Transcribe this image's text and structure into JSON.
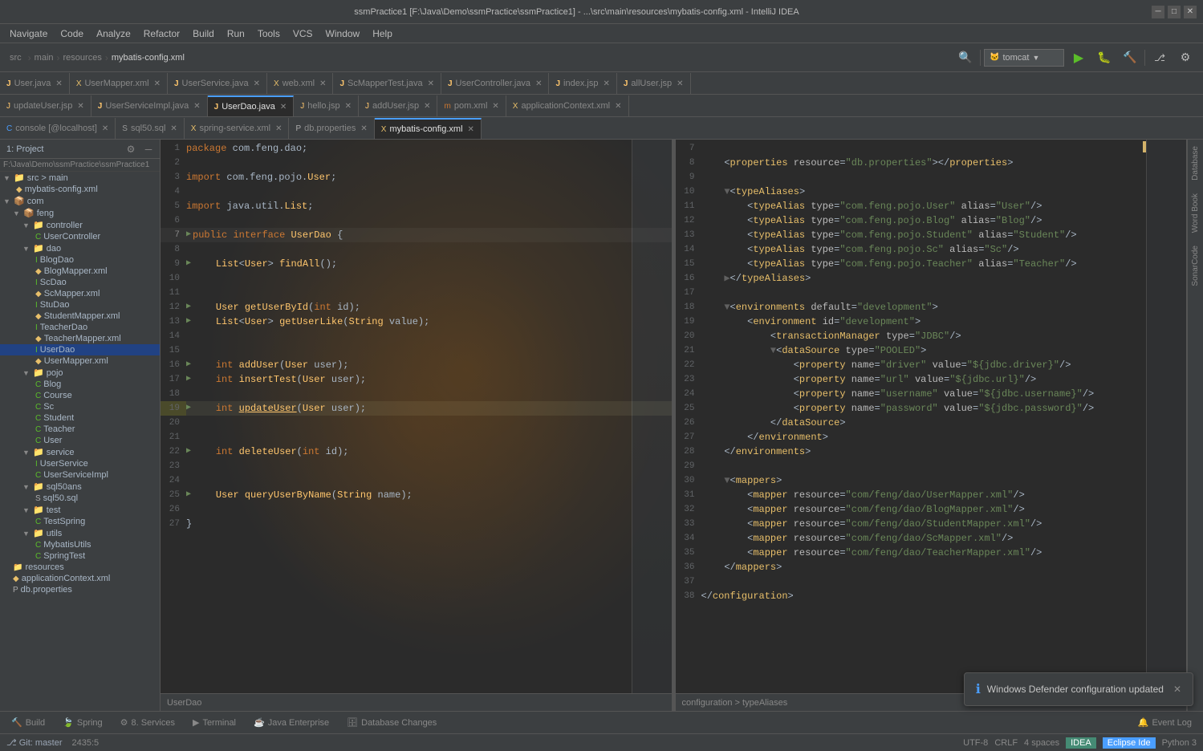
{
  "title_bar": {
    "title": "ssmPractice1 [F:\\Java\\Demo\\ssmPractice\\ssmPractice1] - ...\\src\\main\\resources\\mybatis-config.xml - IntelliJ IDEA"
  },
  "menu": {
    "items": [
      "Navigate",
      "Code",
      "Analyze",
      "Refactor",
      "Build",
      "Run",
      "Tools",
      "VCS",
      "Window",
      "Help"
    ]
  },
  "toolbar": {
    "path": "src  main  resources  mybatis-config.xml",
    "tomcat_label": "tomcat"
  },
  "tabs_row1": [
    {
      "label": "User.java",
      "active": false,
      "icon": "J"
    },
    {
      "label": "UserMapper.xml",
      "active": false,
      "icon": "X"
    },
    {
      "label": "UserService.java",
      "active": false,
      "icon": "J"
    },
    {
      "label": "web.xml",
      "active": false,
      "icon": "X"
    },
    {
      "label": "ScMapperTest.java",
      "active": false,
      "icon": "J"
    },
    {
      "label": "UserController.java",
      "active": false,
      "icon": "J"
    },
    {
      "label": "index.jsp",
      "active": false,
      "icon": "J"
    },
    {
      "label": "allUser.jsp",
      "active": false,
      "icon": "J"
    }
  ],
  "tabs_row2": [
    {
      "label": "updateUser.jsp",
      "active": false,
      "icon": "J"
    },
    {
      "label": "UserServiceImpl.java",
      "active": false,
      "icon": "J"
    },
    {
      "label": "UserDao.java",
      "active": true,
      "icon": "J"
    },
    {
      "label": "hello.jsp",
      "active": false,
      "icon": "J"
    },
    {
      "label": "addUser.jsp",
      "active": false,
      "icon": "J"
    },
    {
      "label": "pom.xml",
      "active": false,
      "icon": "X"
    },
    {
      "label": "applicationContext.xml",
      "active": false,
      "icon": "X"
    }
  ],
  "tabs_row3": [
    {
      "label": "console [@localhost]",
      "active": false,
      "icon": "C"
    },
    {
      "label": "sql50.sql",
      "active": false,
      "icon": "S"
    },
    {
      "label": "spring-service.xml",
      "active": false,
      "icon": "X"
    },
    {
      "label": "db.properties",
      "active": false,
      "icon": "P"
    },
    {
      "label": "mybatis-config.xml",
      "active": true,
      "icon": "X"
    }
  ],
  "left_panel": {
    "title": "Project",
    "breadcrumb": "F:\\Java\\Demo\\ssmPractice\\ssmPractice1",
    "tree": [
      {
        "level": 0,
        "label": "src",
        "icon": "📁",
        "expanded": true
      },
      {
        "level": 1,
        "label": "main",
        "icon": "📁",
        "expanded": true
      },
      {
        "level": 2,
        "label": "resources",
        "icon": "📁",
        "expanded": false
      },
      {
        "level": 1,
        "label": "com",
        "icon": "📦",
        "expanded": true
      },
      {
        "level": 2,
        "label": "feng",
        "icon": "📦",
        "expanded": true
      },
      {
        "level": 3,
        "label": "controller",
        "icon": "📁",
        "expanded": true
      },
      {
        "level": 4,
        "label": "UserController",
        "icon": "C"
      },
      {
        "level": 3,
        "label": "dao",
        "icon": "📁",
        "expanded": true
      },
      {
        "level": 4,
        "label": "BlogDao",
        "icon": "I"
      },
      {
        "level": 4,
        "label": "BlogMapper.xml",
        "icon": "X"
      },
      {
        "level": 4,
        "label": "ScDao",
        "icon": "I"
      },
      {
        "level": 4,
        "label": "ScMapper.xml",
        "icon": "X"
      },
      {
        "level": 4,
        "label": "StuDao",
        "icon": "I"
      },
      {
        "level": 4,
        "label": "StudentMapper.xml",
        "icon": "X"
      },
      {
        "level": 4,
        "label": "TeacherDao",
        "icon": "I"
      },
      {
        "level": 4,
        "label": "TeacherMapper.xml",
        "icon": "X"
      },
      {
        "level": 4,
        "label": "UserDao",
        "icon": "I"
      },
      {
        "level": 4,
        "label": "UserMapper.xml",
        "icon": "X"
      },
      {
        "level": 3,
        "label": "pojo",
        "icon": "📁",
        "expanded": true
      },
      {
        "level": 4,
        "label": "Blog",
        "icon": "C"
      },
      {
        "level": 4,
        "label": "Course",
        "icon": "C"
      },
      {
        "level": 4,
        "label": "Sc",
        "icon": "C"
      },
      {
        "level": 4,
        "label": "Student",
        "icon": "C"
      },
      {
        "level": 4,
        "label": "Teacher",
        "icon": "C"
      },
      {
        "level": 4,
        "label": "User",
        "icon": "C"
      },
      {
        "level": 3,
        "label": "service",
        "icon": "📁",
        "expanded": true
      },
      {
        "level": 4,
        "label": "UserService",
        "icon": "I"
      },
      {
        "level": 4,
        "label": "UserServiceImpl",
        "icon": "C"
      },
      {
        "level": 3,
        "label": "sql50ans",
        "icon": "📁",
        "expanded": true
      },
      {
        "level": 4,
        "label": "sql50.sql",
        "icon": "S"
      },
      {
        "level": 3,
        "label": "test",
        "icon": "📁",
        "expanded": true
      },
      {
        "level": 4,
        "label": "TestSpring",
        "icon": "C"
      },
      {
        "level": 3,
        "label": "utils",
        "icon": "📁",
        "expanded": true
      },
      {
        "level": 4,
        "label": "MybatisUtils",
        "icon": "C"
      },
      {
        "level": 4,
        "label": "SpringTest",
        "icon": "C"
      },
      {
        "level": 2,
        "label": "resources",
        "icon": "📁"
      },
      {
        "level": 1,
        "label": "applicationContext.xml",
        "icon": "X"
      },
      {
        "level": 1,
        "label": "db.properties",
        "icon": "P"
      }
    ]
  },
  "center_code": {
    "filename": "UserDao.java",
    "lines": [
      {
        "num": 1,
        "text": "package com.feng.dao;",
        "indent": 0
      },
      {
        "num": 2,
        "text": "",
        "indent": 0
      },
      {
        "num": 3,
        "text": "import com.feng.pojo.User;",
        "indent": 0
      },
      {
        "num": 4,
        "text": "",
        "indent": 0
      },
      {
        "num": 5,
        "text": "import java.util.List;",
        "indent": 0
      },
      {
        "num": 6,
        "text": "",
        "indent": 0
      },
      {
        "num": 7,
        "text": "public interface UserDao {",
        "indent": 0
      },
      {
        "num": 8,
        "text": "",
        "indent": 0
      },
      {
        "num": 9,
        "text": "    List<User> findAll();",
        "indent": 1
      },
      {
        "num": 10,
        "text": "",
        "indent": 0
      },
      {
        "num": 11,
        "text": "",
        "indent": 0
      },
      {
        "num": 12,
        "text": "    User getUserById(int id);",
        "indent": 1
      },
      {
        "num": 13,
        "text": "    List<User> getUserLike(String value);",
        "indent": 1
      },
      {
        "num": 14,
        "text": "",
        "indent": 0
      },
      {
        "num": 15,
        "text": "",
        "indent": 0
      },
      {
        "num": 16,
        "text": "    int addUser(User user);",
        "indent": 1
      },
      {
        "num": 17,
        "text": "    int insertTest(User user);",
        "indent": 1
      },
      {
        "num": 18,
        "text": "",
        "indent": 0
      },
      {
        "num": 19,
        "text": "    int updateUser(User user);",
        "indent": 1,
        "highlight": true
      },
      {
        "num": 20,
        "text": "",
        "indent": 0
      },
      {
        "num": 21,
        "text": "",
        "indent": 0
      },
      {
        "num": 22,
        "text": "    int deleteUser(int id);",
        "indent": 1
      },
      {
        "num": 23,
        "text": "",
        "indent": 0
      },
      {
        "num": 24,
        "text": "",
        "indent": 0
      },
      {
        "num": 25,
        "text": "    User queryUserByName(String name);",
        "indent": 1
      },
      {
        "num": 26,
        "text": "",
        "indent": 0
      },
      {
        "num": 27,
        "text": "}",
        "indent": 0
      }
    ],
    "breadcrumb": "UserDao"
  },
  "right_code": {
    "filename": "mybatis-config.xml",
    "lines": [
      {
        "num": 7,
        "text": ""
      },
      {
        "num": 8,
        "text": "    <properties resource=\"db.properties\"></properties>"
      },
      {
        "num": 9,
        "text": ""
      },
      {
        "num": 10,
        "text": "    <typeAliases>",
        "fold": true
      },
      {
        "num": 11,
        "text": "        <typeAlias type=\"com.feng.pojo.User\" alias=\"User\"/>"
      },
      {
        "num": 12,
        "text": "        <typeAlias type=\"com.feng.pojo.Blog\" alias=\"Blog\"/>"
      },
      {
        "num": 13,
        "text": "        <typeAlias type=\"com.feng.pojo.Student\" alias=\"Student\"/>"
      },
      {
        "num": 14,
        "text": "        <typeAlias type=\"com.feng.pojo.Sc\" alias=\"Sc\"/>"
      },
      {
        "num": 15,
        "text": "        <typeAlias type=\"com.feng.pojo.Teacher\" alias=\"Teacher\"/>"
      },
      {
        "num": 16,
        "text": "    </typeAliases>",
        "fold": true
      },
      {
        "num": 17,
        "text": ""
      },
      {
        "num": 18,
        "text": "    <environments default=\"development\">",
        "fold": true
      },
      {
        "num": 19,
        "text": "        <environment id=\"development\">"
      },
      {
        "num": 20,
        "text": "            <transactionManager type=\"JDBC\"/>"
      },
      {
        "num": 21,
        "text": "            <dataSource type=\"POOLED\">",
        "fold": true
      },
      {
        "num": 22,
        "text": "                <property name=\"driver\" value=\"${jdbc.driver}\"/>"
      },
      {
        "num": 23,
        "text": "                <property name=\"url\" value=\"${jdbc.url}\"/>"
      },
      {
        "num": 24,
        "text": "                <property name=\"username\" value=\"${jdbc.username}\"/>"
      },
      {
        "num": 25,
        "text": "                <property name=\"password\" value=\"${jdbc.password}\"/>"
      },
      {
        "num": 26,
        "text": "            </dataSource>"
      },
      {
        "num": 27,
        "text": "        </environment>"
      },
      {
        "num": 28,
        "text": "    </environments>"
      },
      {
        "num": 29,
        "text": ""
      },
      {
        "num": 30,
        "text": "    <mappers>",
        "fold": true
      },
      {
        "num": 31,
        "text": "        <mapper resource=\"com/feng/dao/UserMapper.xml\"/>"
      },
      {
        "num": 32,
        "text": "        <mapper resource=\"com/feng/dao/BlogMapper.xml\"/>"
      },
      {
        "num": 33,
        "text": "        <mapper resource=\"com/feng/dao/StudentMapper.xml\"/>"
      },
      {
        "num": 34,
        "text": "        <mapper resource=\"com/feng/dao/ScMapper.xml\"/>"
      },
      {
        "num": 35,
        "text": "        <mapper resource=\"com/feng/dao/TeacherMapper.xml\"/>"
      },
      {
        "num": 36,
        "text": "    </mappers>"
      },
      {
        "num": 37,
        "text": ""
      },
      {
        "num": 38,
        "text": "</configuration>"
      }
    ],
    "breadcrumb": "configuration > typeAliases"
  },
  "bottom_tabs": [
    {
      "label": "Build",
      "icon": "🔨",
      "active": false
    },
    {
      "label": "Spring",
      "icon": "🍃",
      "active": false
    },
    {
      "label": "8. Services",
      "icon": "⚙",
      "active": false
    },
    {
      "label": "Terminal",
      "icon": ">_",
      "active": false
    },
    {
      "label": "Java Enterprise",
      "icon": "☕",
      "active": false
    },
    {
      "label": "Database Changes",
      "icon": "🗄",
      "active": false
    }
  ],
  "status_bar": {
    "line_col": "2435",
    "encoding": "UTF-8",
    "line_sep": "CRLF",
    "spaces": "4 spaces",
    "git_branch": "Git: master",
    "ide_label": "IDEA",
    "eclipse_label": "Eclipse Ide",
    "python_label": "Python 3"
  },
  "notification": {
    "text": "Windows Defender configuration updated",
    "icon": "ℹ"
  },
  "right_panel_labels": [
    "Database",
    "Word Book",
    "SonarCode"
  ]
}
